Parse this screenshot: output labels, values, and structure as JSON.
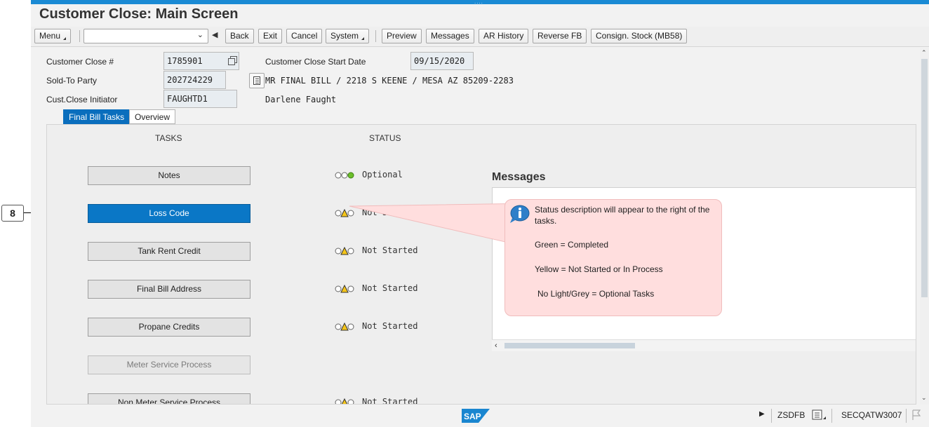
{
  "callout": {
    "number": "8"
  },
  "window": {
    "title": "Customer Close: Main Screen",
    "grip": "...."
  },
  "toolbar": {
    "menu": "Menu",
    "command_value": "",
    "back": "Back",
    "exit": "Exit",
    "cancel": "Cancel",
    "system": "System",
    "preview": "Preview",
    "messages": "Messages",
    "ar_history": "AR History",
    "reverse_fb": "Reverse FB",
    "consign_stock": "Consign. Stock (MB58)"
  },
  "header": {
    "customer_close_label": "Customer Close #",
    "customer_close_value": "1785901",
    "start_date_label": "Customer Close Start Date",
    "start_date_value": "09/15/2020",
    "sold_to_label": "Sold-To Party",
    "sold_to_value": "202724229",
    "sold_to_description": "MR FINAL BILL / 2218 S KEENE / MESA AZ 85209-2283",
    "initiator_label": "Cust.Close Initiator",
    "initiator_value": "FAUGHTD1",
    "initiator_name": "Darlene Faught"
  },
  "tabs": [
    {
      "label": "Final Bill Tasks",
      "active": true
    },
    {
      "label": "Overview",
      "active": false
    }
  ],
  "panel": {
    "tasks_header": "TASKS",
    "status_header": "STATUS",
    "tasks": [
      {
        "label": "Notes",
        "status": "Optional",
        "light": "green",
        "state": "normal"
      },
      {
        "label": "Loss Code",
        "status": "Not Started",
        "light": "yellow",
        "state": "primary"
      },
      {
        "label": "Tank Rent Credit",
        "status": "Not Started",
        "light": "yellow",
        "state": "normal"
      },
      {
        "label": "Final Bill Address",
        "status": "Not Started",
        "light": "yellow",
        "state": "normal"
      },
      {
        "label": "Propane Credits",
        "status": "Not Started",
        "light": "yellow",
        "state": "normal"
      },
      {
        "label": "Meter Service Process",
        "status": "",
        "light": "none",
        "state": "disabled"
      },
      {
        "label": "Non Meter Service Process",
        "status": "Not Started",
        "light": "yellow",
        "state": "normal"
      }
    ]
  },
  "messages": {
    "title": "Messages",
    "note_intro": "Status description will appear to the right of the tasks.",
    "note_green": "Green = Completed",
    "note_yellow": "Yellow = Not Started or In Process",
    "note_grey": "No Light/Grey = Optional Tasks"
  },
  "statusbar": {
    "logo": "SAP",
    "transaction": "ZSDFB",
    "system": "SECQATW3007"
  },
  "colors": {
    "accent": "#0a77c6",
    "topbar": "#1a8ad4",
    "light_green": "#6cbf2a",
    "light_yellow": "#f5c518",
    "sticky": "#ffdede"
  }
}
